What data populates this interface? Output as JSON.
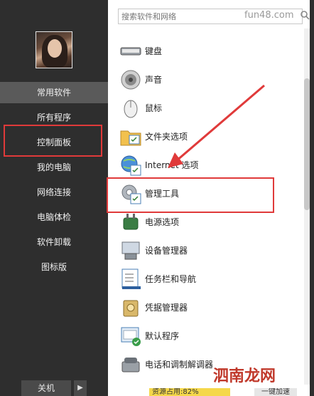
{
  "search": {
    "placeholder": "搜索软件和网络"
  },
  "watermark_top": "fun48.com",
  "sidebar": {
    "items": [
      {
        "label": "常用软件"
      },
      {
        "label": "所有程序"
      },
      {
        "label": "控制面板"
      },
      {
        "label": "我的电脑"
      },
      {
        "label": "网络连接"
      },
      {
        "label": "电脑体检"
      },
      {
        "label": "软件卸载"
      },
      {
        "label": "图标版"
      }
    ],
    "shutdown": "关机"
  },
  "panel": {
    "items": [
      {
        "label": "键盘",
        "icon": "keyboard-icon"
      },
      {
        "label": "声音",
        "icon": "speaker-icon"
      },
      {
        "label": "鼠标",
        "icon": "mouse-icon"
      },
      {
        "label": "文件夹选项",
        "icon": "folder-options-icon"
      },
      {
        "label": "Internet 选项",
        "icon": "internet-options-icon"
      },
      {
        "label": "管理工具",
        "icon": "admin-tools-icon"
      },
      {
        "label": "电源选项",
        "icon": "power-options-icon"
      },
      {
        "label": "设备管理器",
        "icon": "device-manager-icon"
      },
      {
        "label": "任务栏和导航",
        "icon": "taskbar-icon"
      },
      {
        "label": "凭据管理器",
        "icon": "credential-manager-icon"
      },
      {
        "label": "默认程序",
        "icon": "default-programs-icon"
      },
      {
        "label": "电话和调制解调器",
        "icon": "phone-modem-icon"
      }
    ]
  },
  "status": {
    "resource": "资源占用:82%",
    "accel": "一键加速"
  },
  "watermark_bottom": "泗南龙网"
}
